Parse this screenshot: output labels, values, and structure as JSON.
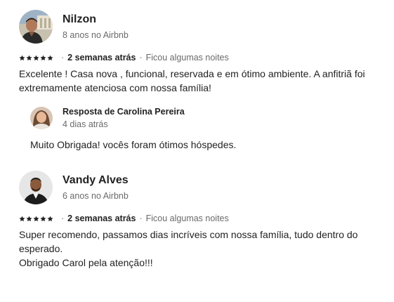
{
  "reviews": [
    {
      "name": "Nilzon",
      "tenure": "8 anos no Airbnb",
      "rating": 5,
      "date": "2 semanas atrás",
      "stay": "Ficou algumas noites",
      "separator": "·",
      "text_lines": [
        "Excelente ! Casa nova , funcional, reservada e em ótimo ambiente. A anfitriã foi extremamente atenciosa com nossa família!"
      ],
      "response": {
        "title": "Resposta de Carolina Pereira",
        "date": "4 dias atrás",
        "text": "Muito Obrigada! vocês foram ótimos hóspedes."
      }
    },
    {
      "name": "Vandy Alves",
      "tenure": "6 anos no Airbnb",
      "rating": 5,
      "date": "2 semanas atrás",
      "stay": "Ficou algumas noites",
      "separator": "·",
      "text_lines": [
        "Super recomendo,  passamos dias incríveis com nossa família, tudo dentro do esperado.",
        "Obrigado Carol pela atenção!!!"
      ]
    }
  ],
  "icons": {
    "star": "star-icon"
  },
  "colors": {
    "text": "#222222",
    "secondary": "#6a6a6a"
  }
}
